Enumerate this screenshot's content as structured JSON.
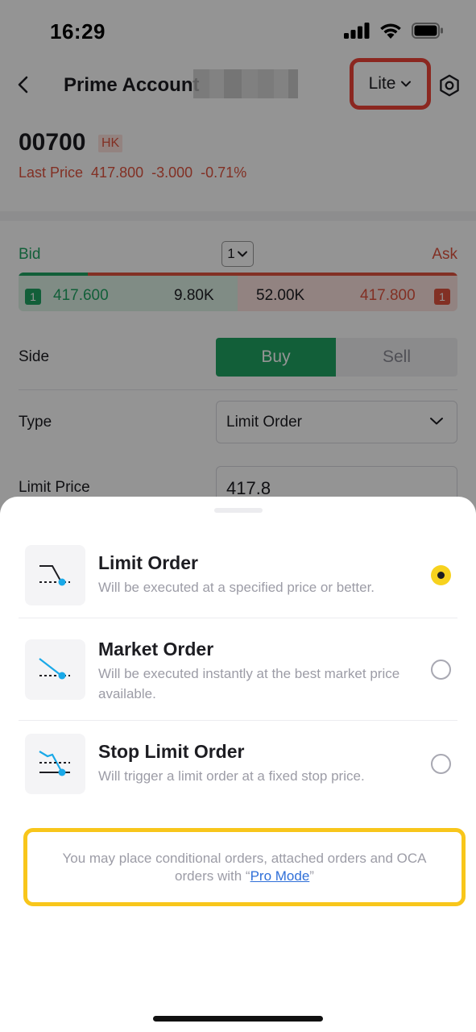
{
  "status_bar": {
    "time": "16:29"
  },
  "nav": {
    "title": "Prime Account",
    "mode_label": "Lite"
  },
  "stock": {
    "symbol": "00700",
    "market": "HK",
    "last_price_label": "Last Price",
    "last_price": "417.800",
    "change": "-3.000",
    "change_pct": "-0.71%"
  },
  "quote": {
    "bid_label": "Bid",
    "ask_label": "Ask",
    "depth": "1",
    "bid_level": "1",
    "bid_price": "417.600",
    "bid_size": "9.80K",
    "ask_size": "52.00K",
    "ask_price": "417.800",
    "ask_level": "1",
    "bid_color": "#1fa463",
    "ask_color": "#e0533f"
  },
  "form": {
    "side_label": "Side",
    "buy_label": "Buy",
    "sell_label": "Sell",
    "type_label": "Type",
    "type_value": "Limit Order",
    "limit_price_label": "Limit Price",
    "limit_price_value": "417.8"
  },
  "sheet": {
    "options": [
      {
        "title": "Limit Order",
        "description": "Will be executed at a specified price or better.",
        "selected": true,
        "icon": "limit-order-icon"
      },
      {
        "title": "Market Order",
        "description": "Will be executed instantly at the best market price available.",
        "selected": false,
        "icon": "market-order-icon"
      },
      {
        "title": "Stop Limit Order",
        "description": "Will trigger a limit order at a fixed stop price.",
        "selected": false,
        "icon": "stop-limit-order-icon"
      }
    ],
    "pro_note_prefix": "You may place conditional orders, attached orders and OCA orders with “",
    "pro_link": "Pro Mode",
    "pro_note_suffix": "”"
  },
  "colors": {
    "highlight_red": "#f04438",
    "highlight_yellow": "#f8c61b",
    "accent_blue": "#1aa9e8",
    "radio_selected": "#f7d21e"
  }
}
